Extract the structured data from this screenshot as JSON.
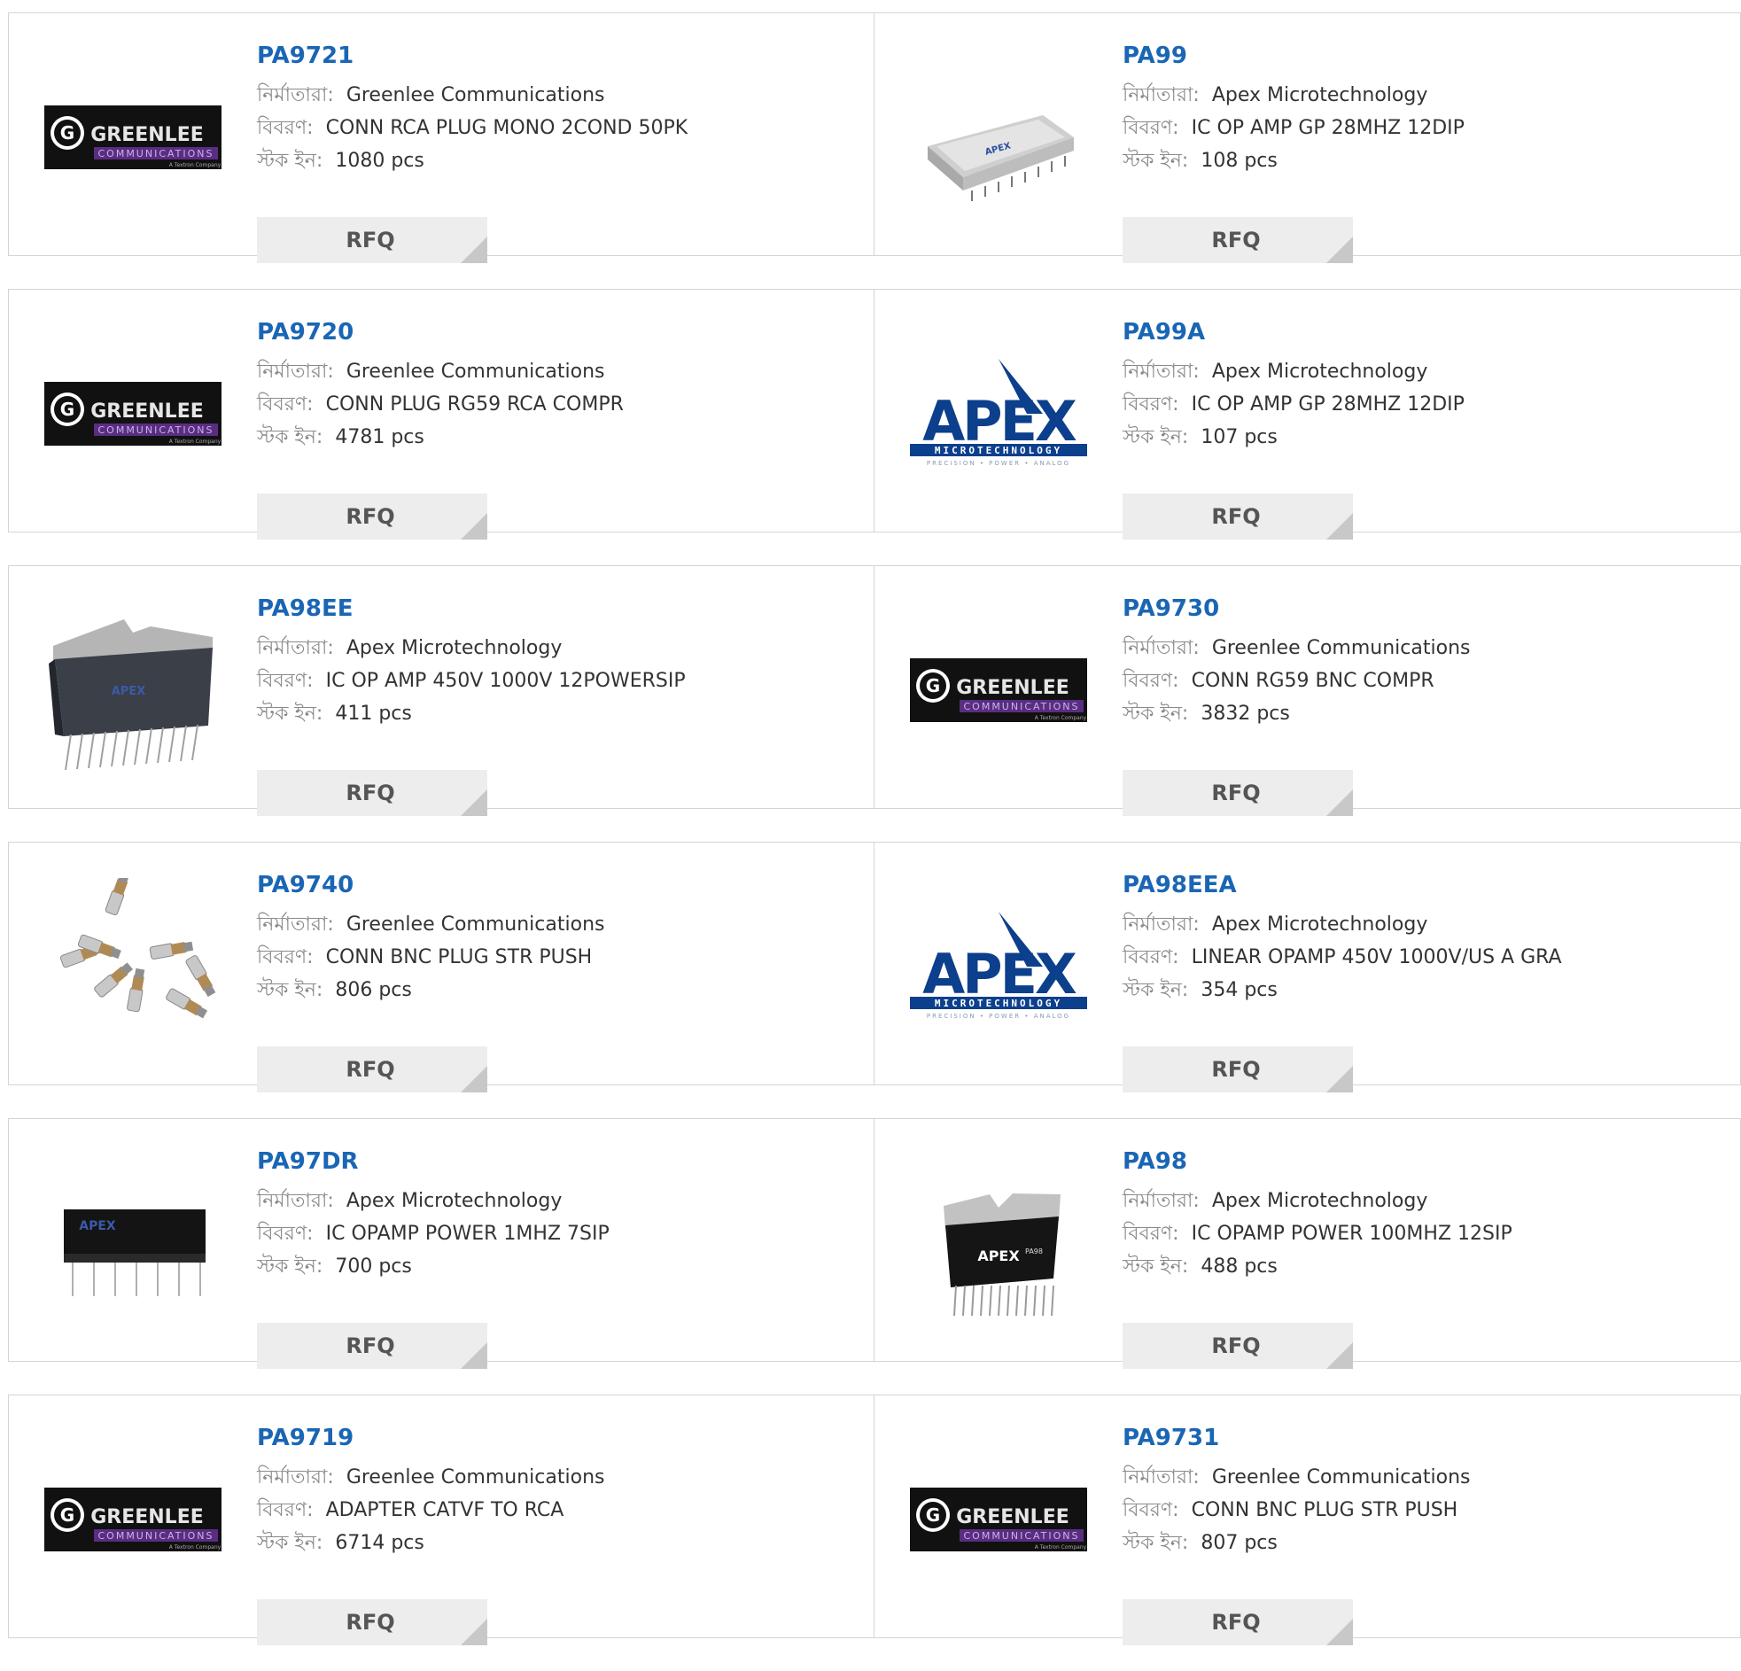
{
  "labels": {
    "manufacturer": "নির্মাতারা:",
    "description": "বিবরণ:",
    "stock": "স্টক ইন:",
    "rfq": "RFQ"
  },
  "products": [
    {
      "part": "PA9721",
      "manufacturer": "Greenlee Communications",
      "description": "CONN RCA PLUG MONO 2COND 50PK",
      "stock": "1080 pcs",
      "image": "greenlee-logo"
    },
    {
      "part": "PA99",
      "manufacturer": "Apex Microtechnology",
      "description": "IC OP AMP GP 28MHZ 12DIP",
      "stock": "108 pcs",
      "image": "apex-dip-module"
    },
    {
      "part": "PA9720",
      "manufacturer": "Greenlee Communications",
      "description": "CONN PLUG RG59 RCA COMPR",
      "stock": "4781 pcs",
      "image": "greenlee-logo"
    },
    {
      "part": "PA99A",
      "manufacturer": "Apex Microtechnology",
      "description": "IC OP AMP GP 28MHZ 12DIP",
      "stock": "107 pcs",
      "image": "apex-logo"
    },
    {
      "part": "PA98EE",
      "manufacturer": "Apex Microtechnology",
      "description": "IC OP AMP 450V 1000V 12POWERSIP",
      "stock": "411 pcs",
      "image": "apex-power-sip"
    },
    {
      "part": "PA9730",
      "manufacturer": "Greenlee Communications",
      "description": "CONN RG59 BNC COMPR",
      "stock": "3832 pcs",
      "image": "greenlee-logo"
    },
    {
      "part": "PA9740",
      "manufacturer": "Greenlee Communications",
      "description": "CONN BNC PLUG STR PUSH",
      "stock": "806 pcs",
      "image": "bnc-connectors"
    },
    {
      "part": "PA98EEA",
      "manufacturer": "Apex Microtechnology",
      "description": "LINEAR OPAMP 450V 1000V/US A GRA",
      "stock": "354 pcs",
      "image": "apex-logo"
    },
    {
      "part": "PA97DR",
      "manufacturer": "Apex Microtechnology",
      "description": "IC OPAMP POWER 1MHZ 7SIP",
      "stock": "700 pcs",
      "image": "apex-sip-black"
    },
    {
      "part": "PA98",
      "manufacturer": "Apex Microtechnology",
      "description": "IC OPAMP POWER 100MHZ 12SIP",
      "stock": "488 pcs",
      "image": "apex-pa98-sip"
    },
    {
      "part": "PA9719",
      "manufacturer": "Greenlee Communications",
      "description": "ADAPTER CATVF TO RCA",
      "stock": "6714 pcs",
      "image": "greenlee-logo"
    },
    {
      "part": "PA9731",
      "manufacturer": "Greenlee Communications",
      "description": "CONN BNC PLUG STR PUSH",
      "stock": "807 pcs",
      "image": "greenlee-logo"
    }
  ],
  "logo_text": {
    "greenlee": "GREENLEE",
    "greenlee_sub": "COMMUNICATIONS",
    "greenlee_tag": "A Textron Company",
    "apex": "APEX",
    "apex_sub": "MICROTECHNOLOGY",
    "apex_tag": "PRECISION • POWER • ANALOG",
    "pa98_mark": "PA98"
  },
  "colors": {
    "part_link": "#1a66b4",
    "label": "#8a8a8a",
    "value": "#333333",
    "button_bg": "#ededed",
    "border": "#d4d4d4",
    "apex_blue": "#0c3f8c",
    "greenlee_purple": "#5a2d82"
  }
}
